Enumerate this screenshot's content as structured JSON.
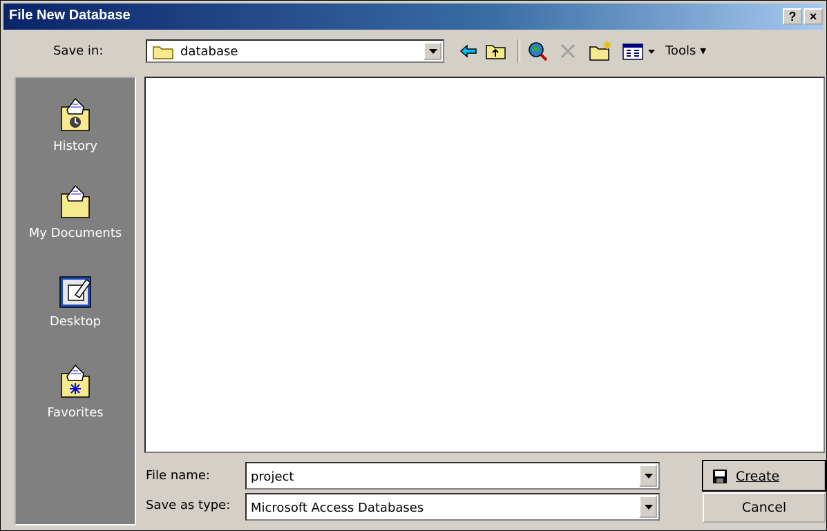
{
  "window": {
    "title": "File New Database"
  },
  "titlebar": {
    "help_label": "?",
    "close_label": "×"
  },
  "toolbar": {
    "save_in_label": "Save in:",
    "save_in_value": "database",
    "tools_label": "Tools ▾",
    "icons": [
      "back-arrow-icon",
      "up-folder-icon",
      "search-web-icon",
      "delete-icon",
      "new-folder-icon",
      "views-icon"
    ]
  },
  "places": [
    {
      "label": "History",
      "icon": "history-folder-icon"
    },
    {
      "label": "My Documents",
      "icon": "my-documents-folder-icon"
    },
    {
      "label": "Desktop",
      "icon": "desktop-icon"
    },
    {
      "label": "Favorites",
      "icon": "favorites-folder-icon"
    }
  ],
  "file_list": {
    "items": []
  },
  "form": {
    "file_name_label": "File name:",
    "file_name_value": "project",
    "save_as_type_label": "Save as type:",
    "save_as_type_value": "Microsoft Access Databases"
  },
  "buttons": {
    "create_label": "Create",
    "cancel_label": "Cancel"
  },
  "colors": {
    "title_start": "#0a246a",
    "title_end": "#a6caf0",
    "face": "#d4d0c8",
    "places_bg": "#808080"
  }
}
